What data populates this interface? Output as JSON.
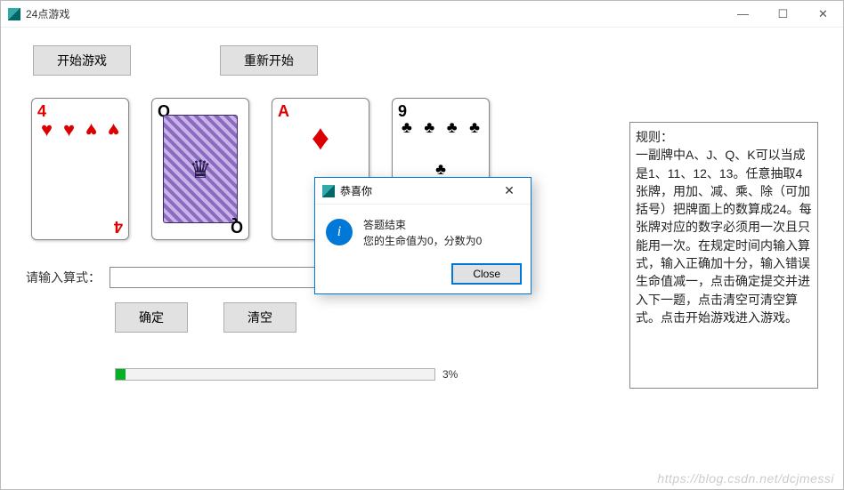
{
  "window": {
    "title": "24点游戏"
  },
  "toolbar": {
    "start_label": "开始游戏",
    "restart_label": "重新开始"
  },
  "cards": [
    {
      "rank": "4",
      "suit": "heart",
      "color": "red"
    },
    {
      "rank": "Q",
      "suit": "spade",
      "color": "black",
      "face": true
    },
    {
      "rank": "A",
      "suit": "diamond",
      "color": "red"
    },
    {
      "rank": "9",
      "suit": "club",
      "color": "black"
    }
  ],
  "input": {
    "label": "请输入算式：",
    "value": ""
  },
  "actions": {
    "confirm_label": "确定",
    "clear_label": "清空"
  },
  "progress": {
    "percent": 3,
    "label": "3%"
  },
  "rules": {
    "title": "规则：",
    "text": "一副牌中A、J、Q、K可以当成是1、11、12、13。任意抽取4张牌，用加、减、乘、除（可加括号）把牌面上的数算成24。每张牌对应的数字必须用一次且只能用一次。在规定时间内输入算式，输入正确加十分，输入错误生命值减一，点击确定提交并进入下一题，点击清空可清空算式。点击开始游戏进入游戏。"
  },
  "dialog": {
    "title": "恭喜你",
    "line1": "答题结束",
    "line2": "您的生命值为0，分数为0",
    "close_label": "Close"
  },
  "watermark": "https://blog.csdn.net/dcjmessi"
}
